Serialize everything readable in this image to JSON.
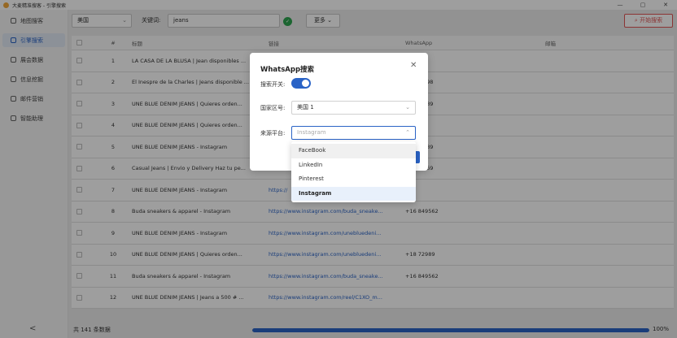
{
  "window": {
    "title": "大麦精准搜客 - 引擎搜索",
    "controls": [
      "—",
      "▢",
      "✕"
    ]
  },
  "sidebar": {
    "items": [
      {
        "label": "地图搜客"
      },
      {
        "label": "引擎搜索"
      },
      {
        "label": "展会数据"
      },
      {
        "label": "信息挖掘"
      },
      {
        "label": "邮件营销"
      },
      {
        "label": "智能助理"
      }
    ],
    "collapse": "<"
  },
  "filters": {
    "country": "美国",
    "keyword_label": "关键词:",
    "keyword": "jeans",
    "more": "更多",
    "start": "开始搜索"
  },
  "table": {
    "headers": {
      "num": "#",
      "title": "标题",
      "link": "链接",
      "whatsapp": "WhatsApp",
      "email": "邮箱"
    },
    "rows": [
      {
        "num": "1",
        "title": "LA CASA DE LA BLUSA | Jean disponibles ...",
        "link": "",
        "whatsapp": ""
      },
      {
        "num": "2",
        "title": "El Inespre de la Charles | Jeans disponible ...",
        "link": "",
        "whatsapp": "+1800498"
      },
      {
        "num": "3",
        "title": "UNE BLUE DENIM JEANS | Quieres orden...",
        "link": "",
        "whatsapp": "+1872989"
      },
      {
        "num": "4",
        "title": "UNE BLUE DENIM JEANS | Quieres orden...",
        "link": "",
        "whatsapp": ""
      },
      {
        "num": "5",
        "title": "UNE BLUE DENIM JEANS - Instagram",
        "link": "",
        "whatsapp": "+1872989"
      },
      {
        "num": "6",
        "title": "Casual Jeans | Envio y Delivery Haz tu pe...",
        "link": "",
        "whatsapp": "+1853369"
      },
      {
        "num": "7",
        "title": "UNE BLUE DENIM JEANS - Instagram",
        "link": "https://",
        "whatsapp": ""
      },
      {
        "num": "8",
        "title": "Buda sneakers & apparel - Instagram",
        "link": "https://www.instagram.com/buda_sneake...",
        "whatsapp": "+16 849562"
      },
      {
        "num": "9",
        "title": "UNE BLUE DENIM JEANS - Instagram",
        "link": "https://www.instagram.com/unebluedeni...",
        "whatsapp": ""
      },
      {
        "num": "10",
        "title": "UNE BLUE DENIM JEANS | Quieres orden...",
        "link": "https://www.instagram.com/unebluedeni...",
        "whatsapp": "+18 72989"
      },
      {
        "num": "11",
        "title": "Buda sneakers & apparel - Instagram",
        "link": "https://www.instagram.com/buda_sneake...",
        "whatsapp": "+16 849562"
      },
      {
        "num": "12",
        "title": "UNE BLUE DENIM JEANS | Jeans a 500 # ...",
        "link": "https://www.instagram.com/reel/C1XO_m...",
        "whatsapp": ""
      }
    ]
  },
  "footer": {
    "total": "共 141 条数据",
    "progress_pct": 100,
    "progress_label": "100%"
  },
  "modal": {
    "title": "WhatsApp搜索",
    "close": "✕",
    "search_switch_label": "搜索开关:",
    "search_switch_on": true,
    "country_label": "国家区号:",
    "country_value": "美国 1",
    "platform_label": "来源平台:",
    "platform_placeholder": "Instagram",
    "platform_options": [
      "FaceBook",
      "LinkedIn",
      "Pinterest",
      "Instagram"
    ],
    "platform_selected": "Instagram"
  },
  "colors": {
    "accent": "#2a63c6",
    "danger": "#e05555",
    "green": "#2ea44f"
  }
}
